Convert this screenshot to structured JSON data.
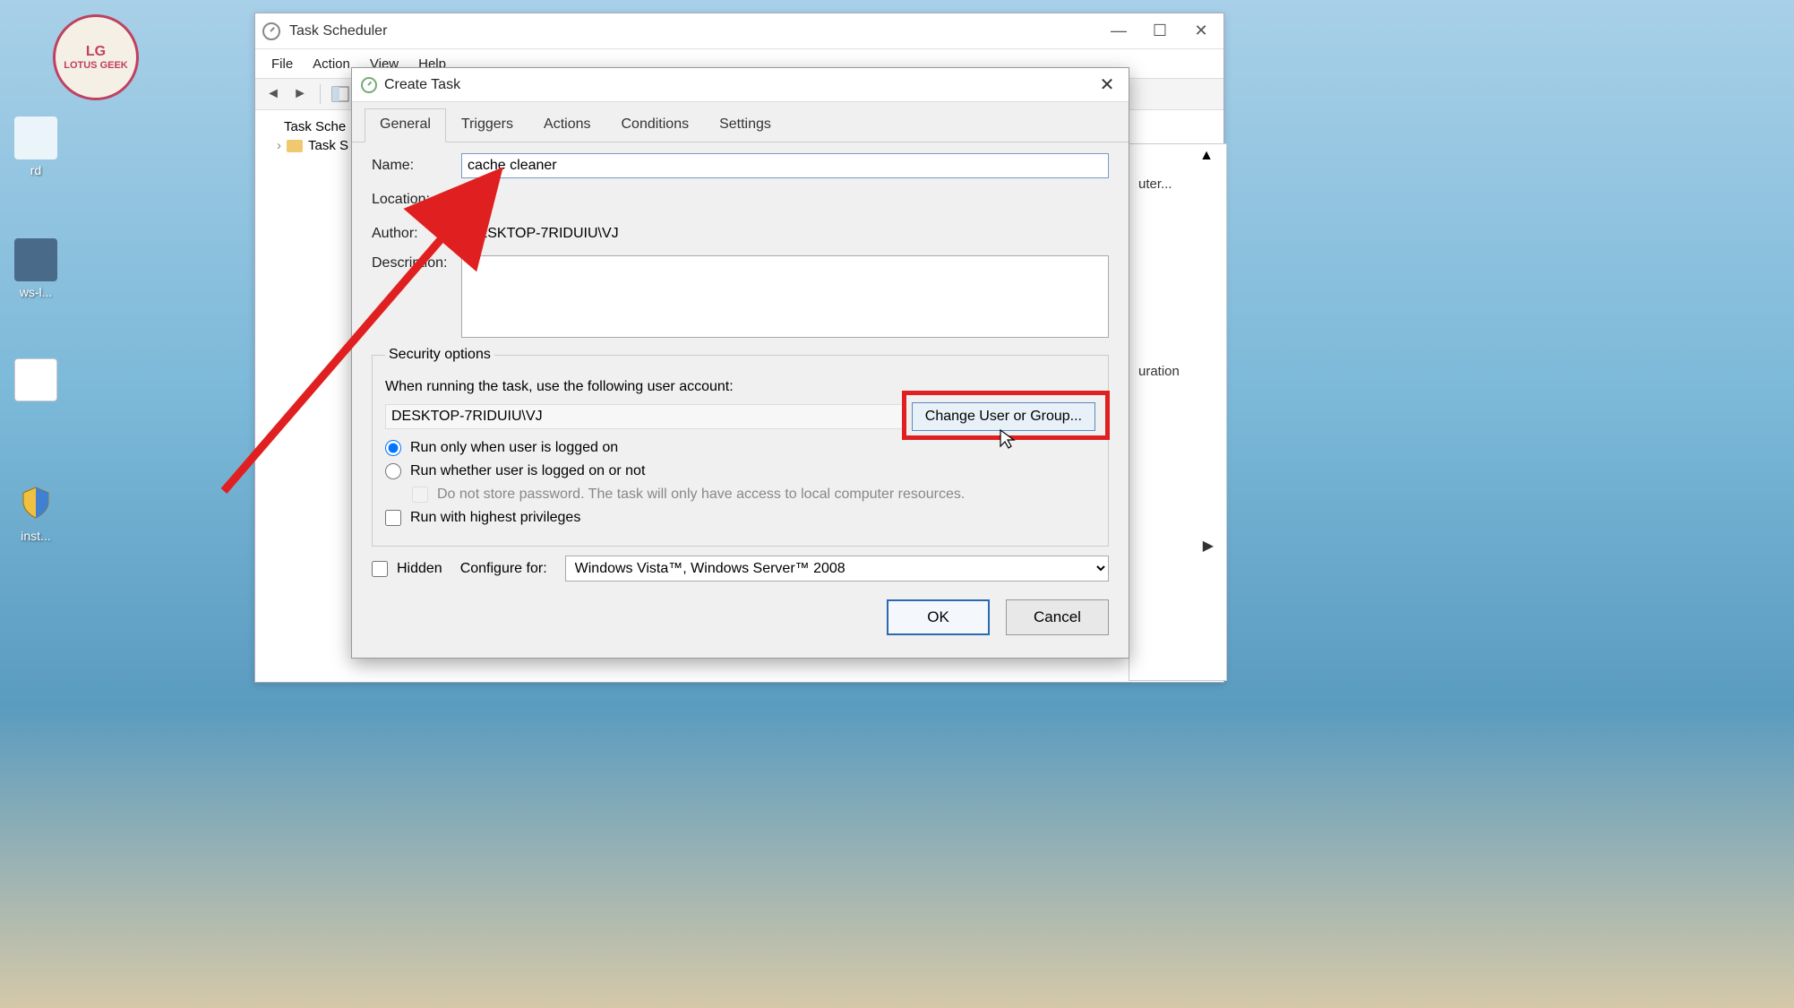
{
  "desktop": {
    "icons": [
      "rd",
      "ws-l...",
      "inst..."
    ],
    "logo": "LOTUS GEEK"
  },
  "main_window": {
    "title": "Task Scheduler",
    "menu": [
      "File",
      "Action",
      "View",
      "Help"
    ],
    "tree": {
      "root": "Task Sche",
      "child": "Task S"
    }
  },
  "right_panel": {
    "row1_suffix": "uter...",
    "row2_suffix": "uration"
  },
  "dialog": {
    "title": "Create Task",
    "tabs": [
      "General",
      "Triggers",
      "Actions",
      "Conditions",
      "Settings"
    ],
    "active_tab": 0,
    "labels": {
      "name": "Name:",
      "location": "Location:",
      "author": "Author:",
      "description": "Description:"
    },
    "values": {
      "name": "cache cleaner",
      "location": "\\",
      "author": "DESKTOP-7RIDUIU\\VJ",
      "description": ""
    },
    "security": {
      "legend": "Security options",
      "when_running": "When running the task, use the following user account:",
      "user": "DESKTOP-7RIDUIU\\VJ",
      "change_btn": "Change User or Group...",
      "radio1": "Run only when user is logged on",
      "radio2": "Run whether user is logged on or not",
      "nopwd": "Do not store password.  The task will only have access to local computer resources.",
      "highest": "Run with highest privileges"
    },
    "bottom": {
      "hidden": "Hidden",
      "configure_for": "Configure for:",
      "configure_value": "Windows Vista™, Windows Server™ 2008"
    },
    "buttons": {
      "ok": "OK",
      "cancel": "Cancel"
    }
  }
}
